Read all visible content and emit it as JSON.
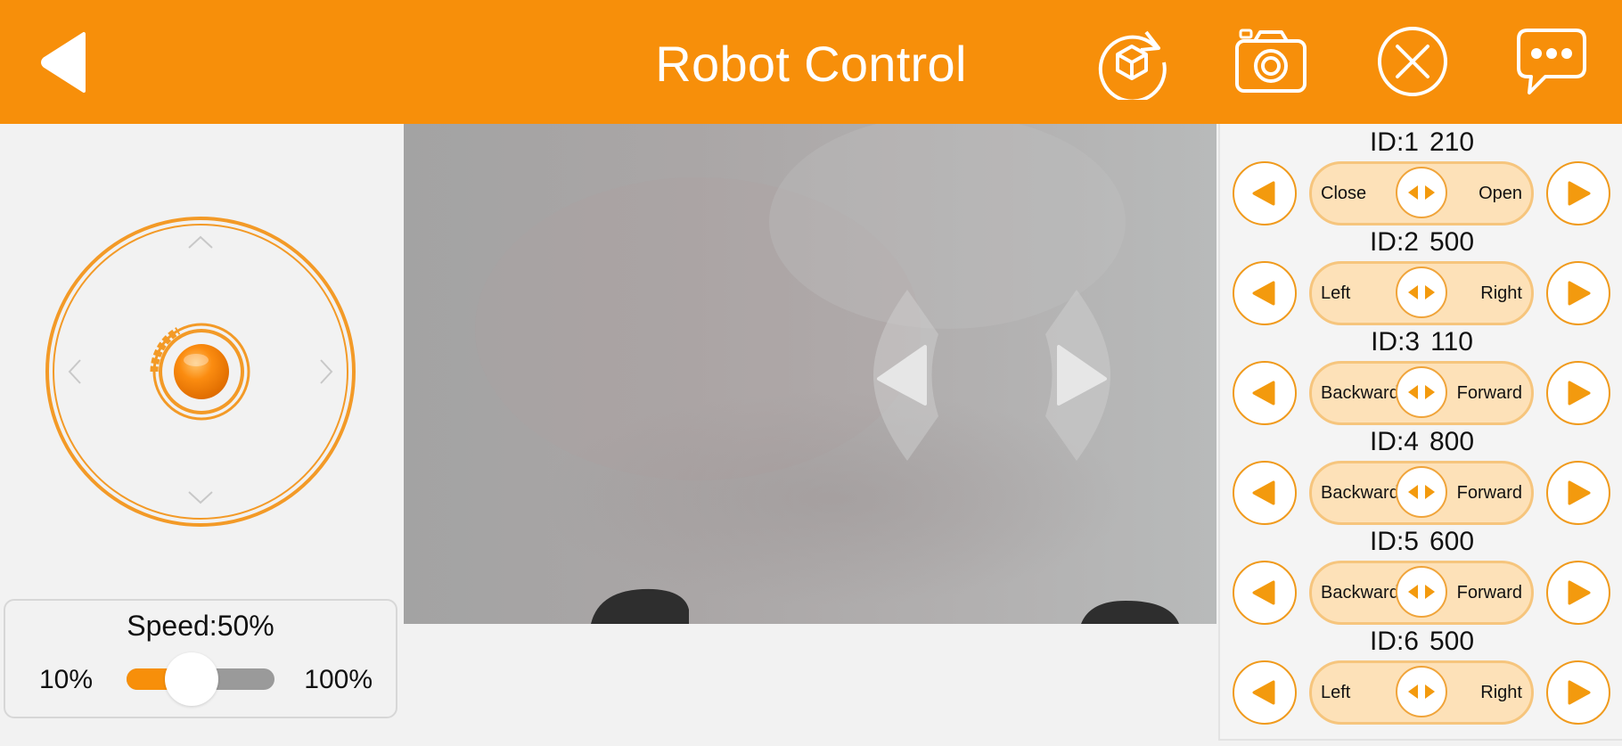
{
  "header": {
    "title": "Robot Control",
    "background": "#f78f0a",
    "icons": [
      "back-icon",
      "reset-3d-icon",
      "camera-icon",
      "close-icon",
      "chat-icon"
    ]
  },
  "joystick": {
    "icons": [
      "chevron-up-icon",
      "chevron-down-icon",
      "chevron-left-icon",
      "chevron-right-icon"
    ]
  },
  "speed": {
    "label": "Speed:50%",
    "min_label": "10%",
    "max_label": "100%",
    "fraction": 0.44
  },
  "camera_view": {
    "icons": [
      "turn-left-icon",
      "turn-right-icon"
    ]
  },
  "servos": [
    {
      "id_label": "ID:1",
      "value": "210",
      "left_label": "Close",
      "right_label": "Open",
      "position": 0.5
    },
    {
      "id_label": "ID:2",
      "value": "500",
      "left_label": "Left",
      "right_label": "Right",
      "position": 0.5
    },
    {
      "id_label": "ID:3",
      "value": "110",
      "left_label": "Backward",
      "right_label": "Forward",
      "position": 0.5
    },
    {
      "id_label": "ID:4",
      "value": "800",
      "left_label": "Backward",
      "right_label": "Forward",
      "position": 0.5
    },
    {
      "id_label": "ID:5",
      "value": "600",
      "left_label": "Backward",
      "right_label": "Forward",
      "position": 0.5
    },
    {
      "id_label": "ID:6",
      "value": "500",
      "left_label": "Left",
      "right_label": "Right",
      "position": 0.5
    }
  ],
  "colors": {
    "accent": "#f78f0a",
    "pill_fill": "#fde1b8",
    "pill_border": "#f6c57d"
  }
}
